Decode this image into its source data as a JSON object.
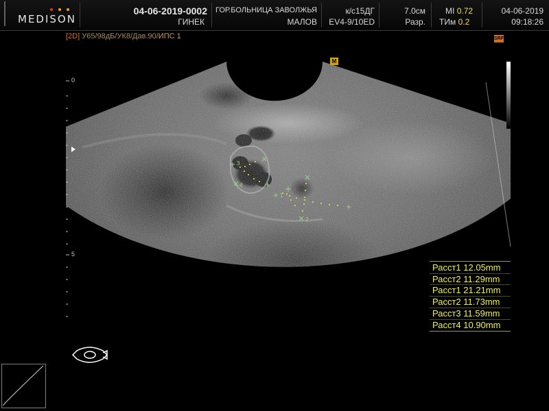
{
  "header": {
    "brand": "MEDISON",
    "brand_dot_colors": [
      "#e2342a",
      "#f2a21c",
      "#f2a21c"
    ],
    "patient_id": "04-06-2019-0002",
    "exam": "ГИНЕК",
    "hospital": "ГОР.БОЛЬНИЦА ЗАВОЛЖЬЯ",
    "operator": "МАЛОВ",
    "probe_code": "к/с15ДГ",
    "probe_model": "EV4-9/10ED",
    "depth": "7.0см",
    "resolution": "Разр.",
    "mi_label": "MI",
    "mi_value": "0.72",
    "tim_label": "ТИм",
    "tim_value": "0.2",
    "date": "04-06-2019",
    "time": "09:18:26"
  },
  "status_line": {
    "mode": "[2D]",
    "params": "У65/98дБ/УК8/Дав.90/",
    "preset": "ИПС 1"
  },
  "badges": {
    "srf": "SRF",
    "marker": "M"
  },
  "depth_scale": {
    "top": "0",
    "mid": "5"
  },
  "calipers": {
    "labels": [
      "1",
      "2",
      "3",
      "4"
    ]
  },
  "measurements": [
    {
      "label": "Расст1",
      "value": "12.05mm"
    },
    {
      "label": "Расст2",
      "value": "11.29mm"
    },
    {
      "label": "Расст1",
      "value": "21.21mm"
    },
    {
      "label": "Расст2",
      "value": "11.73mm"
    },
    {
      "label": "Расст3",
      "value": "11.59mm"
    },
    {
      "label": "Расст4",
      "value": "10.90mm"
    }
  ],
  "colors": {
    "accent_yellow": "#f2f24a",
    "caliper_green": "#9bd08a",
    "status_orange": "#e07020"
  },
  "icons": {
    "probe_orientation": "probe-orientation-icon",
    "depth_pointer": "depth-pointer-icon"
  }
}
